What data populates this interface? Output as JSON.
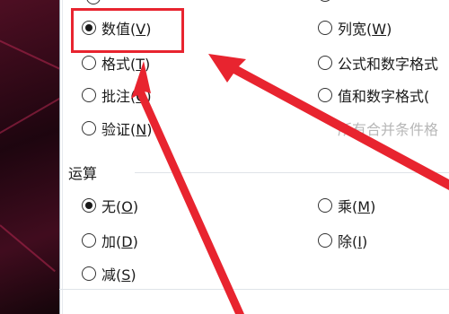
{
  "paste_special": {
    "paste_options": [
      {
        "text": "数值(",
        "key": "V",
        "suffix": ")",
        "checked": true
      },
      {
        "text": "格式(",
        "key": "T",
        "suffix": ")",
        "checked": false
      },
      {
        "text": "批注(",
        "key": "C",
        "suffix": ")",
        "checked": false
      },
      {
        "text": "验证(",
        "key": "N",
        "suffix": ")",
        "checked": false
      },
      {
        "text": "列宽(",
        "key": "W",
        "suffix": ")",
        "checked": false
      },
      {
        "text": "公式和数字格式",
        "key": "",
        "suffix": "",
        "checked": false
      },
      {
        "text": "值和数字格式(",
        "key": "",
        "suffix": "",
        "checked": false
      },
      {
        "text": "所有合并条件格",
        "key": "",
        "suffix": "",
        "checked": false,
        "disabled": true
      }
    ],
    "operation_label": "运算",
    "operation_options": [
      {
        "text": "无(",
        "key": "O",
        "suffix": ")",
        "checked": true
      },
      {
        "text": "加(",
        "key": "D",
        "suffix": ")",
        "checked": false
      },
      {
        "text": "减(",
        "key": "S",
        "suffix": ")",
        "checked": false
      },
      {
        "text": "乘(",
        "key": "M",
        "suffix": ")",
        "checked": false
      },
      {
        "text": "除(",
        "key": "I",
        "suffix": ")",
        "checked": false
      }
    ]
  },
  "colors": {
    "annotation_red": "#e8242f",
    "dialog_bg": "#ffffff",
    "disabled_text": "#b7b7b7"
  }
}
